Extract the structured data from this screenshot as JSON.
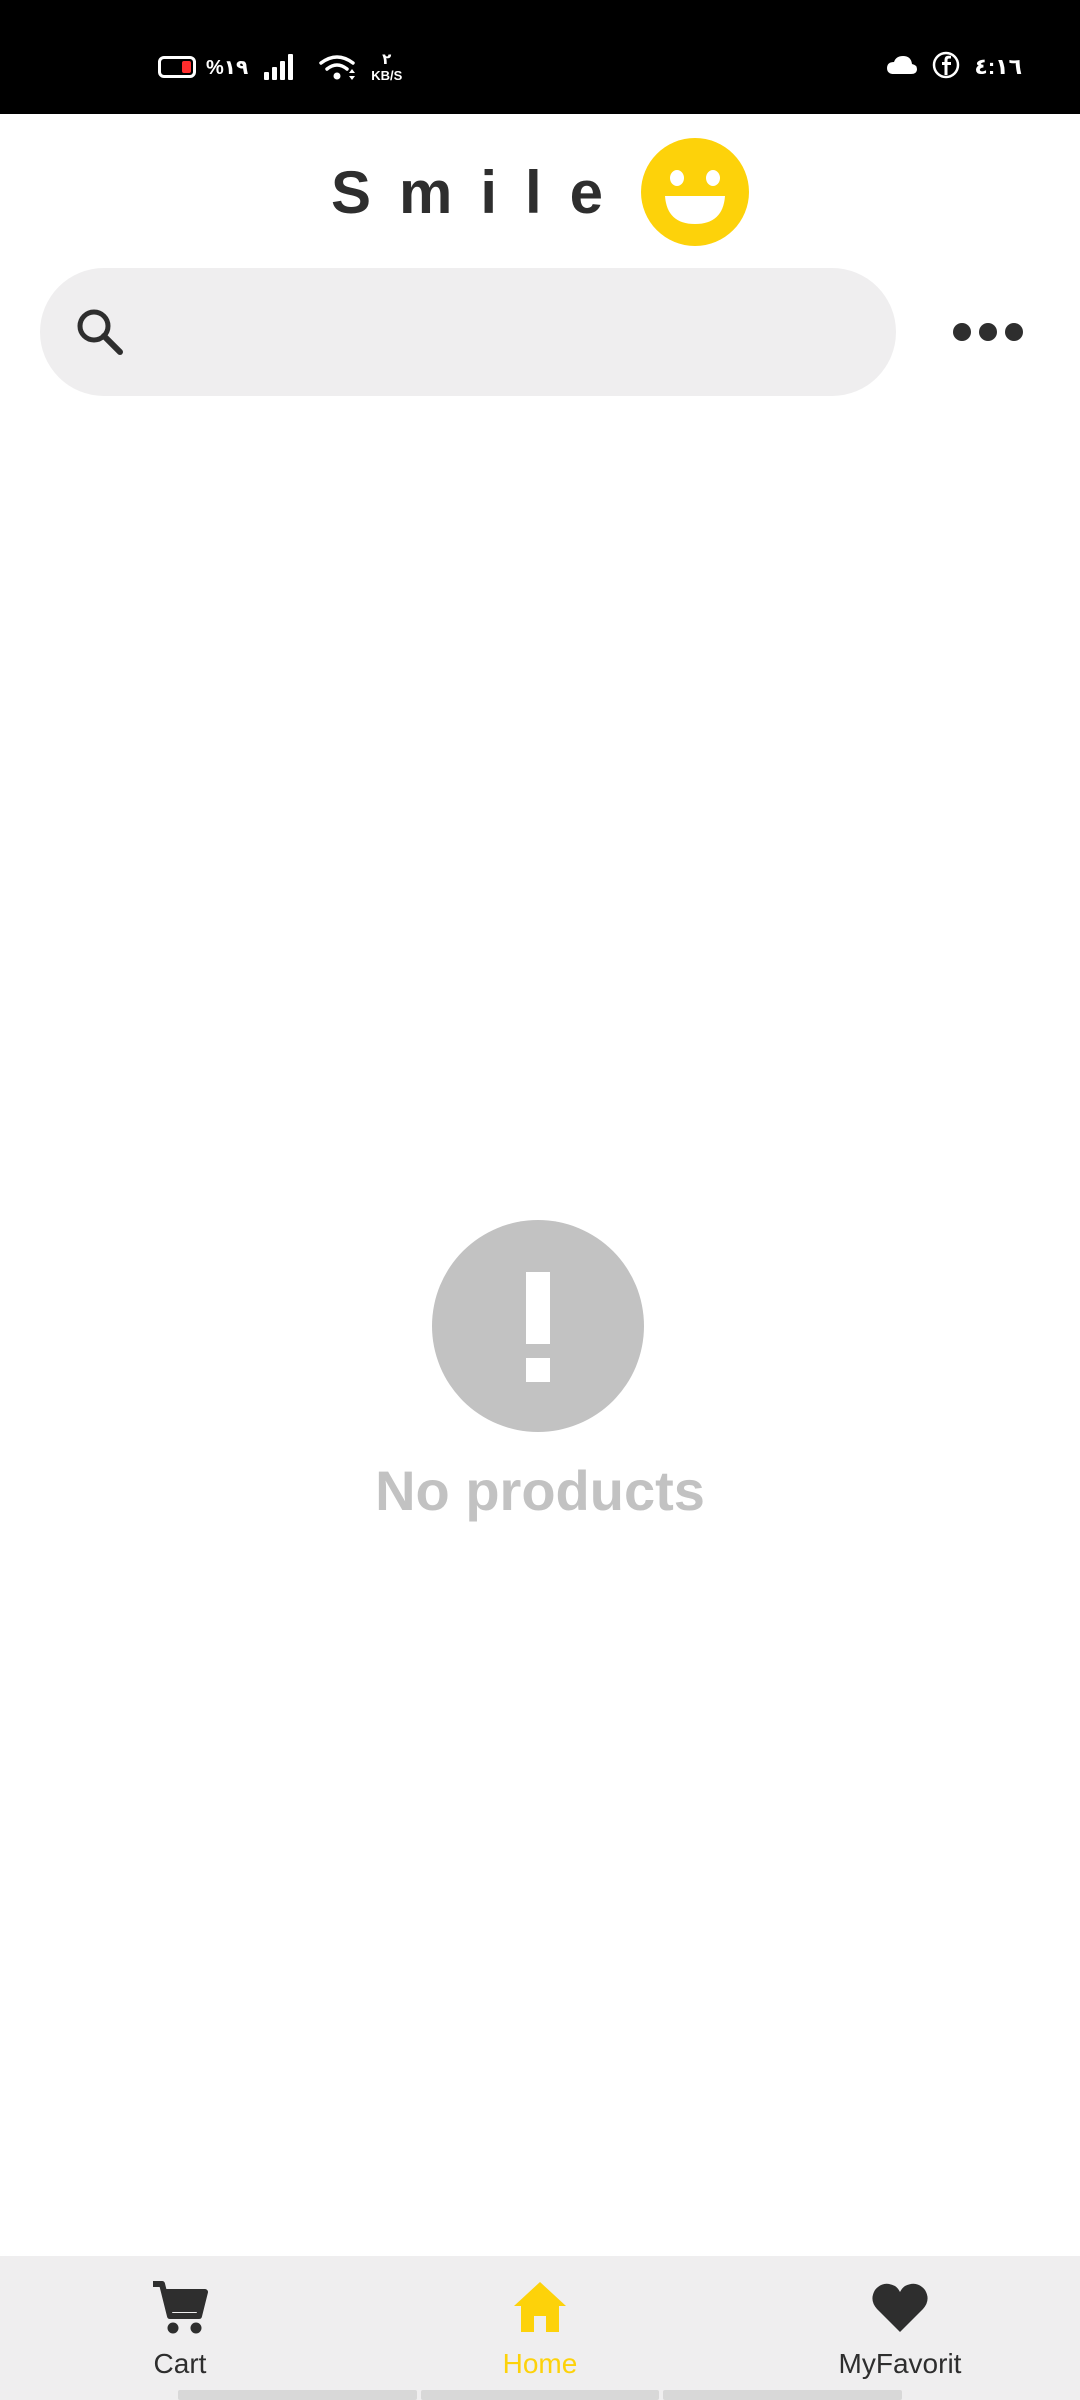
{
  "status_bar": {
    "battery_percent": "%١٩",
    "net_speed_value": "٢",
    "net_speed_unit": "KB/S",
    "time": "٤:١٦",
    "icons": [
      "battery-icon",
      "signal-icon",
      "wifi-icon",
      "cloud-icon",
      "facebook-icon"
    ]
  },
  "header": {
    "brand_name": "Smile",
    "logo_icon": "smiley-icon"
  },
  "search": {
    "placeholder": "",
    "value": ""
  },
  "menu": {
    "icon": "more-dots-icon"
  },
  "empty_state": {
    "icon": "exclamation-icon",
    "message": "No products"
  },
  "bottom_nav": {
    "items": [
      {
        "label": "Cart",
        "icon": "cart-icon",
        "active": false
      },
      {
        "label": "Home",
        "icon": "home-icon",
        "active": true
      },
      {
        "label": "MyFavorit",
        "icon": "heart-icon",
        "active": false
      }
    ]
  },
  "colors": {
    "accent": "#fdd20a",
    "dark": "#2e2e2e",
    "muted": "#c2c2c2",
    "surface": "#efeeef"
  }
}
